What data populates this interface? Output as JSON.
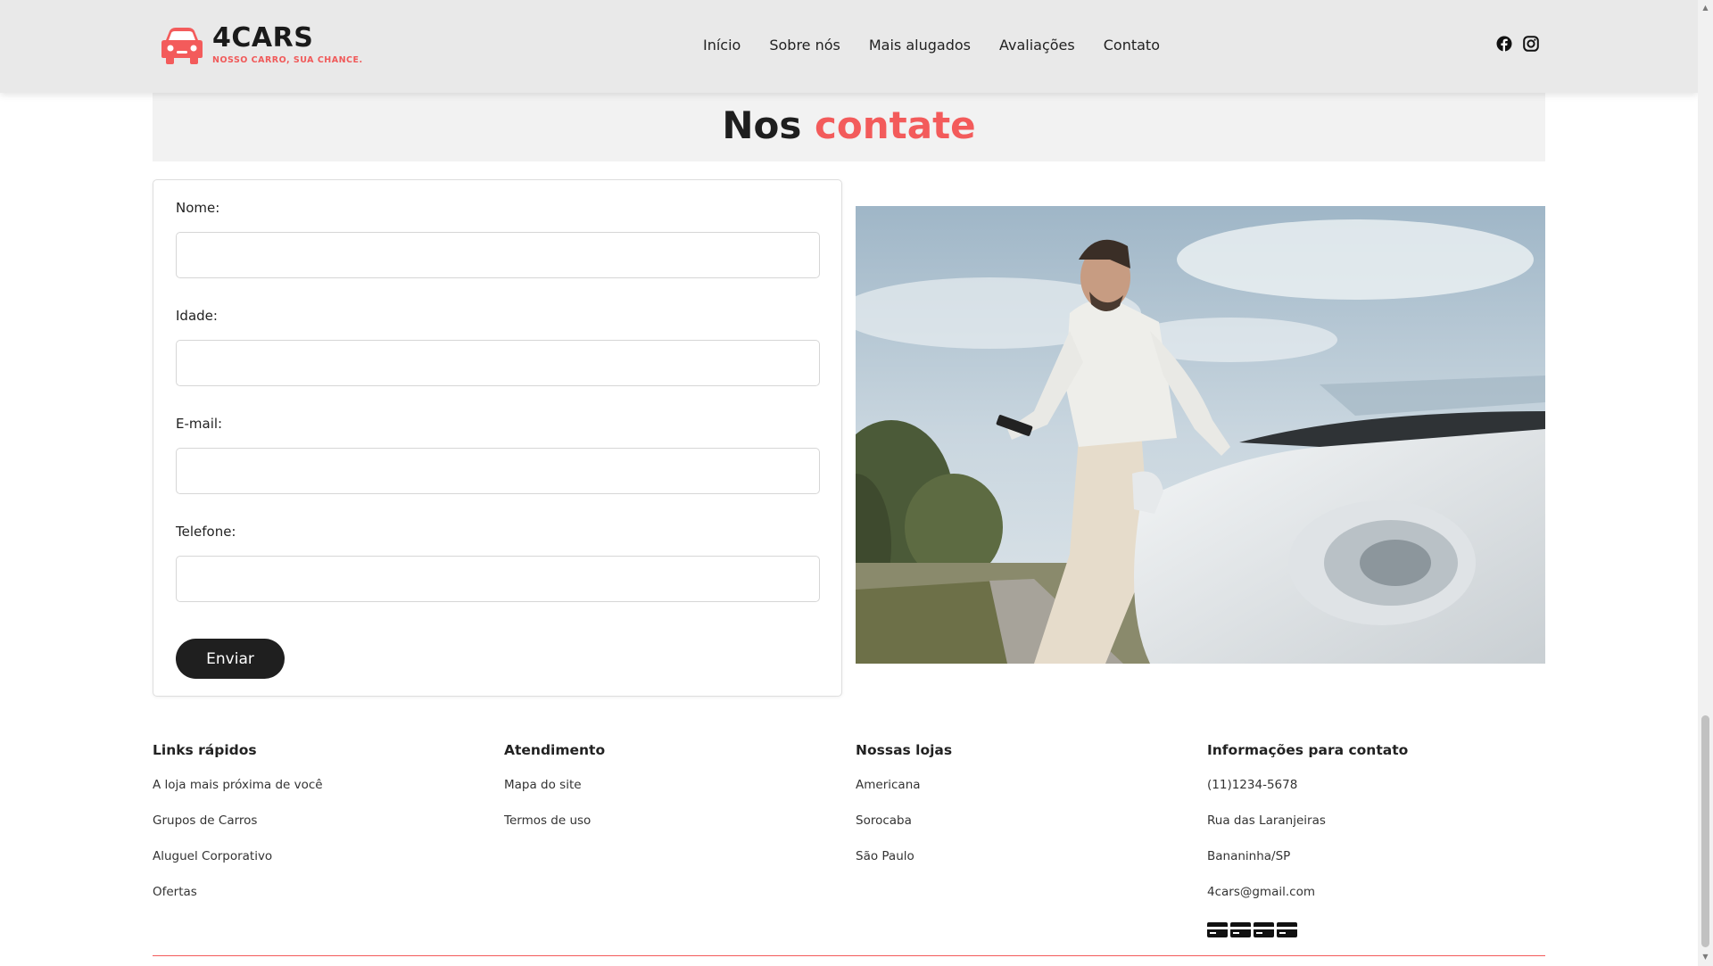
{
  "brand": {
    "name": "4CARS",
    "tagline": "NOSSO CARRO, SUA CHANCE.",
    "accent_color": "#f35b5b"
  },
  "nav": {
    "items": [
      "Início",
      "Sobre nós",
      "Mais alugados",
      "Avaliações",
      "Contato"
    ]
  },
  "social": {
    "icons": [
      "facebook-icon",
      "instagram-icon"
    ]
  },
  "contact": {
    "title_main": "Nos",
    "title_accent": "contate",
    "fields": [
      {
        "label": "Nome:",
        "value": ""
      },
      {
        "label": "Idade:",
        "value": ""
      },
      {
        "label": "E-mail:",
        "value": ""
      },
      {
        "label": "Telefone:",
        "value": ""
      }
    ],
    "submit_label": "Enviar"
  },
  "footer": {
    "columns": [
      {
        "title": "Links rápidos",
        "items": [
          "A loja mais próxima de você",
          "Grupos de Carros",
          "Aluguel Corporativo",
          "Ofertas"
        ]
      },
      {
        "title": "Atendimento",
        "items": [
          "Mapa do site",
          "Termos de uso"
        ]
      },
      {
        "title": "Nossas lojas",
        "items": [
          "Americana",
          "Sorocaba",
          "São Paulo"
        ]
      },
      {
        "title": "Informações para contato",
        "items": [
          "(11)1234-5678",
          "Rua das Laranjeiras",
          "Bananinha/SP",
          "4cars@gmail.com"
        ]
      }
    ],
    "payment_icons": [
      "credit-card-icon",
      "credit-card-icon",
      "credit-card-icon",
      "credit-card-icon"
    ]
  }
}
